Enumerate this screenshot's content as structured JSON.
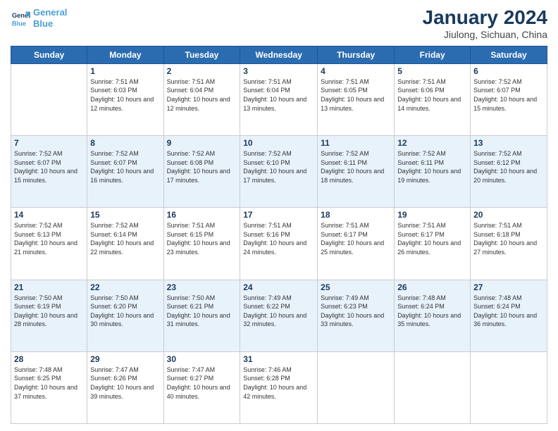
{
  "header": {
    "logo_line1": "General",
    "logo_line2": "Blue",
    "main_title": "January 2024",
    "subtitle": "Jiulong, Sichuan, China"
  },
  "days": [
    "Sunday",
    "Monday",
    "Tuesday",
    "Wednesday",
    "Thursday",
    "Friday",
    "Saturday"
  ],
  "weeks": [
    [
      {
        "date": "",
        "sunrise": "",
        "sunset": "",
        "daylight": "",
        "empty": true
      },
      {
        "date": "1",
        "sunrise": "Sunrise: 7:51 AM",
        "sunset": "Sunset: 6:03 PM",
        "daylight": "Daylight: 10 hours and 12 minutes.",
        "empty": false
      },
      {
        "date": "2",
        "sunrise": "Sunrise: 7:51 AM",
        "sunset": "Sunset: 6:04 PM",
        "daylight": "Daylight: 10 hours and 12 minutes.",
        "empty": false
      },
      {
        "date": "3",
        "sunrise": "Sunrise: 7:51 AM",
        "sunset": "Sunset: 6:04 PM",
        "daylight": "Daylight: 10 hours and 13 minutes.",
        "empty": false
      },
      {
        "date": "4",
        "sunrise": "Sunrise: 7:51 AM",
        "sunset": "Sunset: 6:05 PM",
        "daylight": "Daylight: 10 hours and 13 minutes.",
        "empty": false
      },
      {
        "date": "5",
        "sunrise": "Sunrise: 7:51 AM",
        "sunset": "Sunset: 6:06 PM",
        "daylight": "Daylight: 10 hours and 14 minutes.",
        "empty": false
      },
      {
        "date": "6",
        "sunrise": "Sunrise: 7:52 AM",
        "sunset": "Sunset: 6:07 PM",
        "daylight": "Daylight: 10 hours and 15 minutes.",
        "empty": false
      }
    ],
    [
      {
        "date": "7",
        "sunrise": "Sunrise: 7:52 AM",
        "sunset": "Sunset: 6:07 PM",
        "daylight": "Daylight: 10 hours and 15 minutes.",
        "empty": false
      },
      {
        "date": "8",
        "sunrise": "Sunrise: 7:52 AM",
        "sunset": "Sunset: 6:07 PM",
        "daylight": "Daylight: 10 hours and 16 minutes.",
        "empty": false
      },
      {
        "date": "9",
        "sunrise": "Sunrise: 7:52 AM",
        "sunset": "Sunset: 6:08 PM",
        "daylight": "Daylight: 10 hours and 17 minutes.",
        "empty": false
      },
      {
        "date": "10",
        "sunrise": "Sunrise: 7:52 AM",
        "sunset": "Sunset: 6:10 PM",
        "daylight": "Daylight: 10 hours and 17 minutes.",
        "empty": false
      },
      {
        "date": "11",
        "sunrise": "Sunrise: 7:52 AM",
        "sunset": "Sunset: 6:11 PM",
        "daylight": "Daylight: 10 hours and 18 minutes.",
        "empty": false
      },
      {
        "date": "12",
        "sunrise": "Sunrise: 7:52 AM",
        "sunset": "Sunset: 6:11 PM",
        "daylight": "Daylight: 10 hours and 19 minutes.",
        "empty": false
      },
      {
        "date": "13",
        "sunrise": "Sunrise: 7:52 AM",
        "sunset": "Sunset: 6:12 PM",
        "daylight": "Daylight: 10 hours and 20 minutes.",
        "empty": false
      }
    ],
    [
      {
        "date": "14",
        "sunrise": "Sunrise: 7:52 AM",
        "sunset": "Sunset: 6:13 PM",
        "daylight": "Daylight: 10 hours and 21 minutes.",
        "empty": false
      },
      {
        "date": "15",
        "sunrise": "Sunrise: 7:52 AM",
        "sunset": "Sunset: 6:14 PM",
        "daylight": "Daylight: 10 hours and 22 minutes.",
        "empty": false
      },
      {
        "date": "16",
        "sunrise": "Sunrise: 7:51 AM",
        "sunset": "Sunset: 6:15 PM",
        "daylight": "Daylight: 10 hours and 23 minutes.",
        "empty": false
      },
      {
        "date": "17",
        "sunrise": "Sunrise: 7:51 AM",
        "sunset": "Sunset: 6:16 PM",
        "daylight": "Daylight: 10 hours and 24 minutes.",
        "empty": false
      },
      {
        "date": "18",
        "sunrise": "Sunrise: 7:51 AM",
        "sunset": "Sunset: 6:17 PM",
        "daylight": "Daylight: 10 hours and 25 minutes.",
        "empty": false
      },
      {
        "date": "19",
        "sunrise": "Sunrise: 7:51 AM",
        "sunset": "Sunset: 6:17 PM",
        "daylight": "Daylight: 10 hours and 26 minutes.",
        "empty": false
      },
      {
        "date": "20",
        "sunrise": "Sunrise: 7:51 AM",
        "sunset": "Sunset: 6:18 PM",
        "daylight": "Daylight: 10 hours and 27 minutes.",
        "empty": false
      }
    ],
    [
      {
        "date": "21",
        "sunrise": "Sunrise: 7:50 AM",
        "sunset": "Sunset: 6:19 PM",
        "daylight": "Daylight: 10 hours and 28 minutes.",
        "empty": false
      },
      {
        "date": "22",
        "sunrise": "Sunrise: 7:50 AM",
        "sunset": "Sunset: 6:20 PM",
        "daylight": "Daylight: 10 hours and 30 minutes.",
        "empty": false
      },
      {
        "date": "23",
        "sunrise": "Sunrise: 7:50 AM",
        "sunset": "Sunset: 6:21 PM",
        "daylight": "Daylight: 10 hours and 31 minutes.",
        "empty": false
      },
      {
        "date": "24",
        "sunrise": "Sunrise: 7:49 AM",
        "sunset": "Sunset: 6:22 PM",
        "daylight": "Daylight: 10 hours and 32 minutes.",
        "empty": false
      },
      {
        "date": "25",
        "sunrise": "Sunrise: 7:49 AM",
        "sunset": "Sunset: 6:23 PM",
        "daylight": "Daylight: 10 hours and 33 minutes.",
        "empty": false
      },
      {
        "date": "26",
        "sunrise": "Sunrise: 7:48 AM",
        "sunset": "Sunset: 6:24 PM",
        "daylight": "Daylight: 10 hours and 35 minutes.",
        "empty": false
      },
      {
        "date": "27",
        "sunrise": "Sunrise: 7:48 AM",
        "sunset": "Sunset: 6:24 PM",
        "daylight": "Daylight: 10 hours and 36 minutes.",
        "empty": false
      }
    ],
    [
      {
        "date": "28",
        "sunrise": "Sunrise: 7:48 AM",
        "sunset": "Sunset: 6:25 PM",
        "daylight": "Daylight: 10 hours and 37 minutes.",
        "empty": false
      },
      {
        "date": "29",
        "sunrise": "Sunrise: 7:47 AM",
        "sunset": "Sunset: 6:26 PM",
        "daylight": "Daylight: 10 hours and 39 minutes.",
        "empty": false
      },
      {
        "date": "30",
        "sunrise": "Sunrise: 7:47 AM",
        "sunset": "Sunset: 6:27 PM",
        "daylight": "Daylight: 10 hours and 40 minutes.",
        "empty": false
      },
      {
        "date": "31",
        "sunrise": "Sunrise: 7:46 AM",
        "sunset": "Sunset: 6:28 PM",
        "daylight": "Daylight: 10 hours and 42 minutes.",
        "empty": false
      },
      {
        "date": "",
        "sunrise": "",
        "sunset": "",
        "daylight": "",
        "empty": true
      },
      {
        "date": "",
        "sunrise": "",
        "sunset": "",
        "daylight": "",
        "empty": true
      },
      {
        "date": "",
        "sunrise": "",
        "sunset": "",
        "daylight": "",
        "empty": true
      }
    ]
  ]
}
